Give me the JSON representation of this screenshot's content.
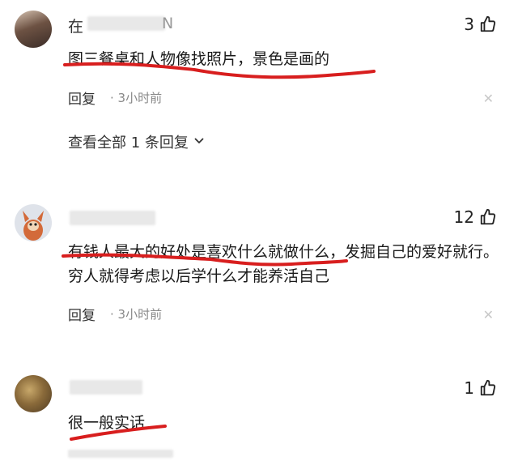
{
  "comments": [
    {
      "username_prefix": "在",
      "username_suffix": "N",
      "likes": "3",
      "text": "图三餐桌和人物像找照片，景色是画的",
      "reply_label": "回复",
      "time": "· 3小时前",
      "view_all": "查看全部 1 条回复"
    },
    {
      "likes": "12",
      "text": "有钱人最大的好处是喜欢什么就做什么，发掘自己的爱好就行。穷人就得考虑以后学什么才能养活自己",
      "reply_label": "回复",
      "time": "· 3小时前"
    },
    {
      "likes": "1",
      "text": "很一般实话"
    }
  ],
  "icons": {
    "like": "thumbs-up-icon",
    "close": "close-icon",
    "chevron": "chevron-down-icon"
  },
  "colors": {
    "underline": "#d81e1e"
  }
}
